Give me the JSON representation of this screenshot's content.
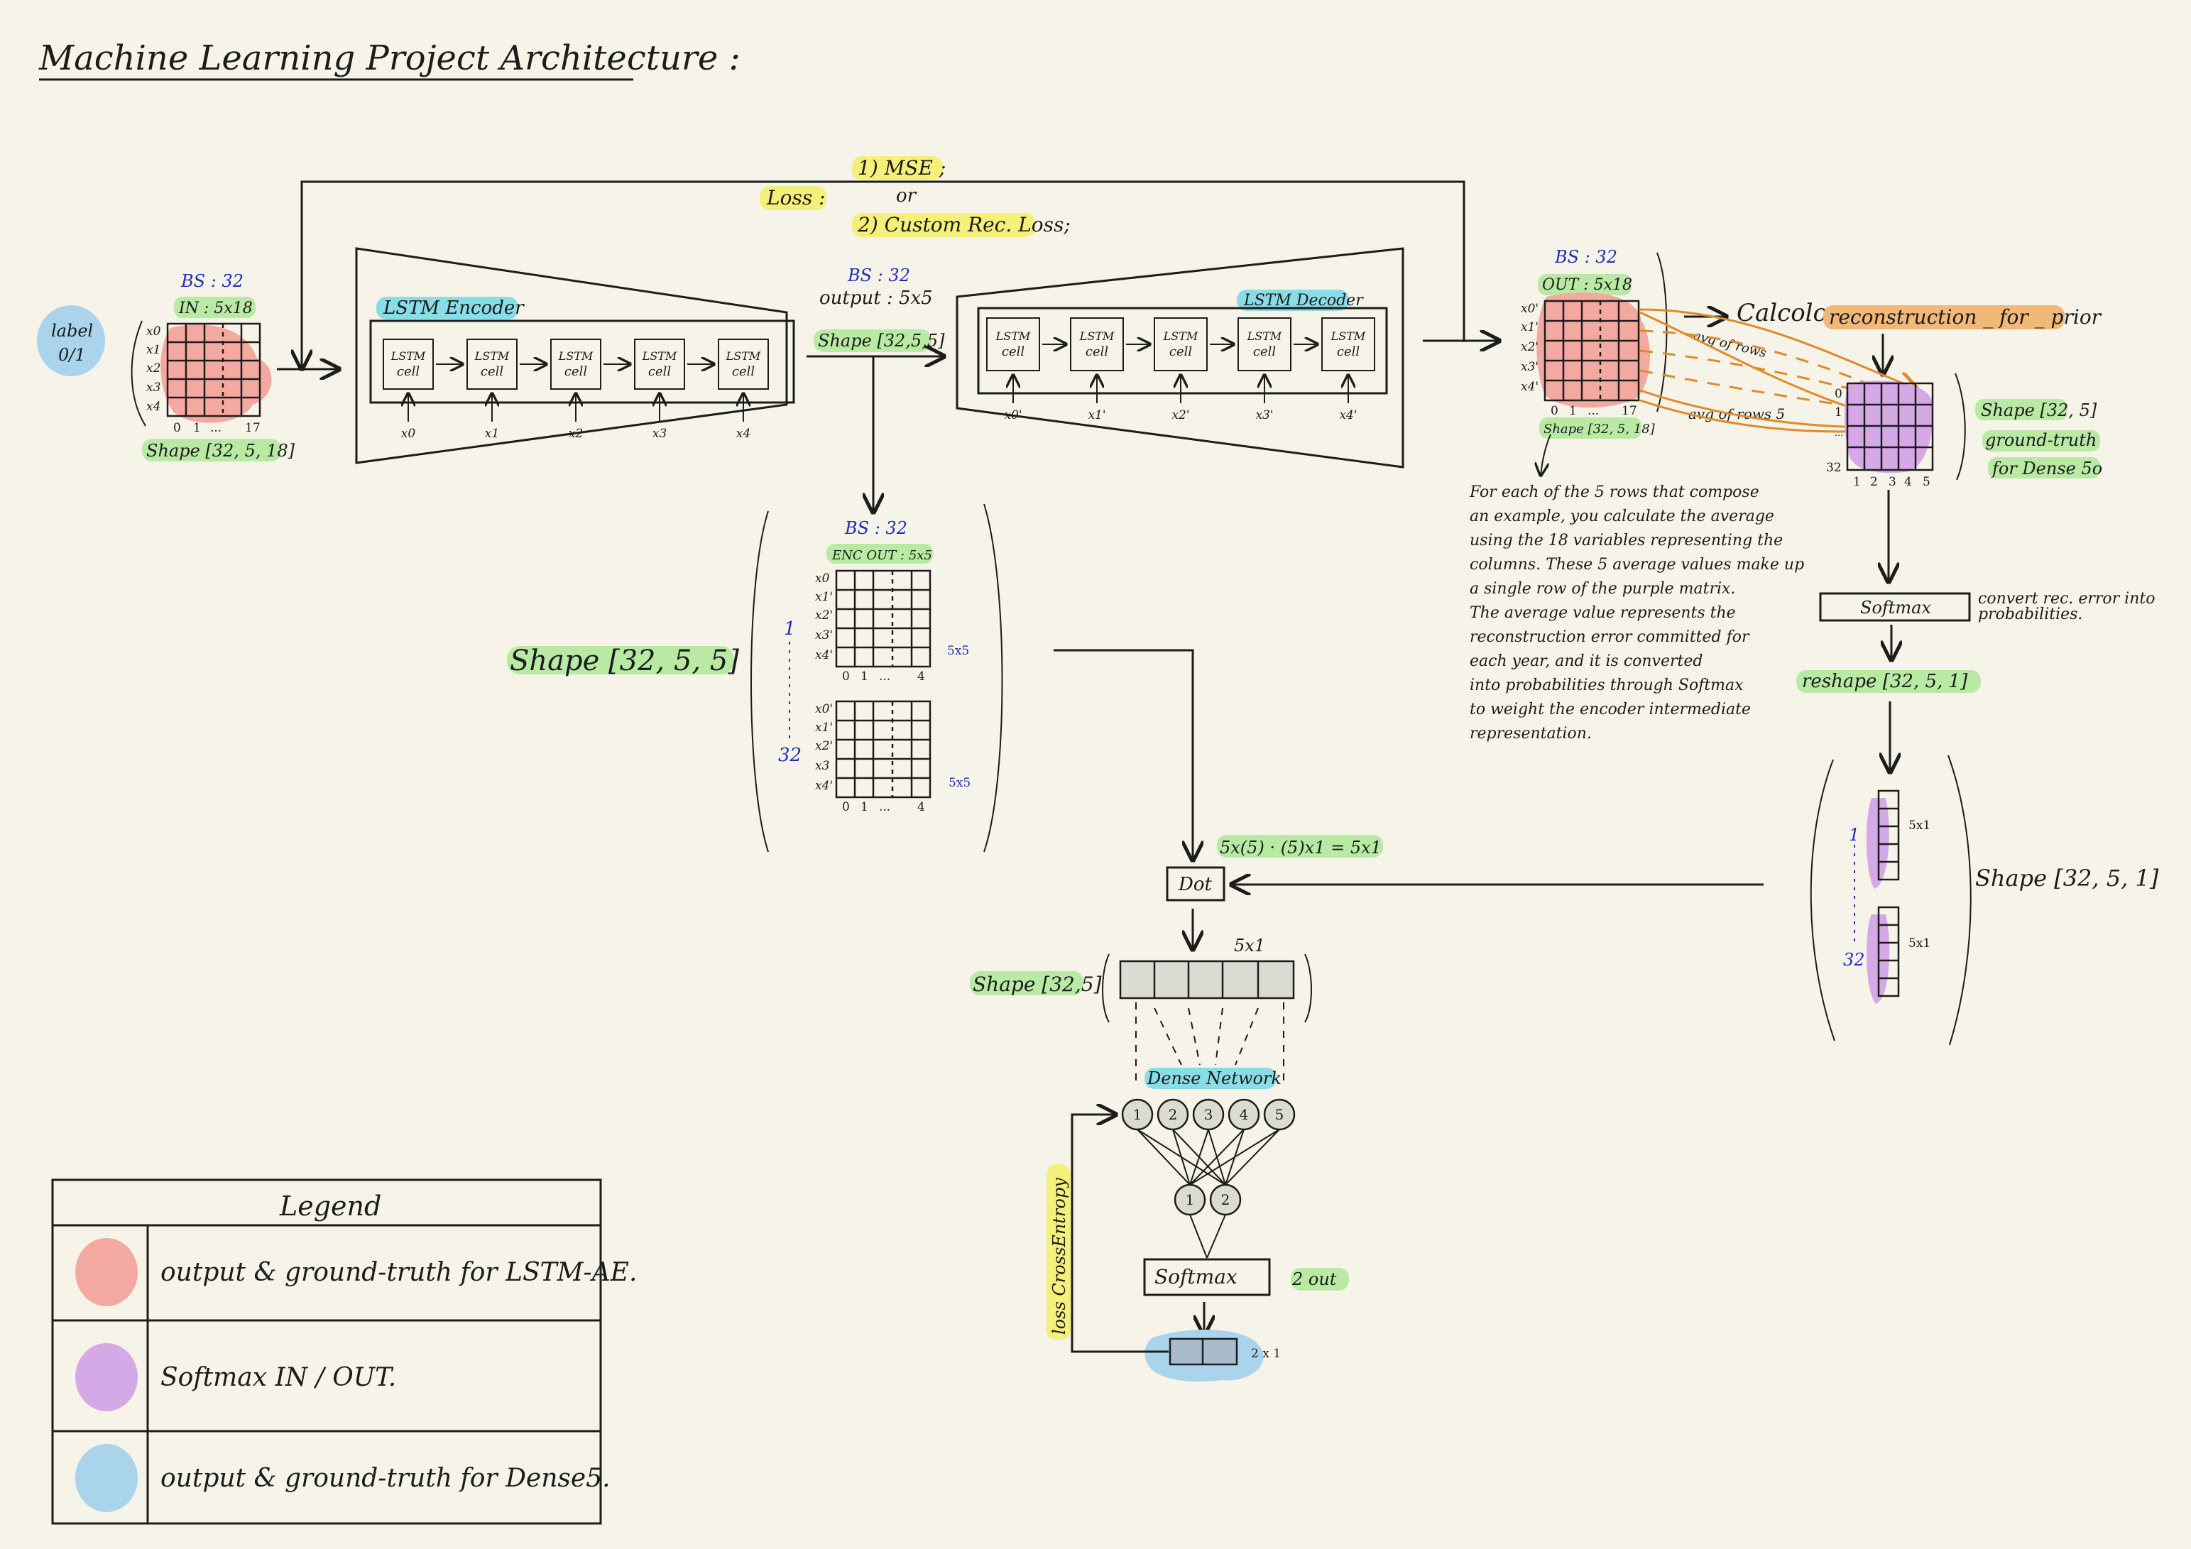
{
  "title": "Machine Learning Project Architecture :",
  "loss": {
    "label": "Loss :",
    "option1": "1) MSE ;",
    "or": "or",
    "option2": "2) Custom Rec. Loss;"
  },
  "input": {
    "label_blob": [
      "label",
      "0/1"
    ],
    "bs": "BS : 32",
    "in": "IN : 5x18",
    "rows": [
      "x0",
      "x1",
      "x2",
      "x3",
      "x4"
    ],
    "cols": [
      "0",
      "1",
      "...",
      "17"
    ],
    "shape": "Shape [32, 5, 18]"
  },
  "encoder": {
    "title": "LSTM Encoder",
    "cells": [
      "LSTM cell",
      "LSTM cell",
      "LSTM cell",
      "LSTM cell",
      "LSTM cell"
    ],
    "inputs": [
      "x0",
      "x1",
      "x2",
      "x3",
      "x4"
    ]
  },
  "encoder_output": {
    "bs": "BS : 32",
    "output": "output : 5x5",
    "shape": "Shape [32,5,5]"
  },
  "decoder": {
    "title": "LSTM Decoder",
    "cells": [
      "LSTM cell",
      "LSTM cell",
      "LSTM cell",
      "LSTM cell",
      "LSTM cell"
    ],
    "inputs": [
      "x0'",
      "x1'",
      "x2'",
      "x3'",
      "x4'"
    ]
  },
  "reconstruction": {
    "bs": "BS : 32",
    "out": "OUT : 5x18",
    "rows": [
      "x0'",
      "x1'",
      "x2'",
      "x3'",
      "x4'"
    ],
    "cols": [
      "0",
      "1",
      "...",
      "17"
    ],
    "shape": "Shape [32, 5, 18]",
    "calcolo": "Calcolo",
    "avg_rows": "avg of rows",
    "avg_rows_5": "avg of rows 5",
    "label": "reconstruction _ for _ prior"
  },
  "prior_matrix": {
    "rows": [
      "0",
      "1",
      "...",
      "32"
    ],
    "cols": [
      "1",
      "2",
      "3",
      "4",
      "5"
    ],
    "shape": "Shape [32, 5]",
    "gt1": "ground-truth",
    "gt2": "for Dense 5o"
  },
  "explanation": [
    "For each of the 5 rows that compose",
    "an example, you calculate the average",
    "using the 18 variables representing the",
    "columns. These 5 average values make up",
    "a single row of the purple matrix.",
    "The average value represents the",
    "reconstruction error committed for",
    "each year, and it is converted",
    "into probabilities through Softmax",
    "to weight the encoder intermediate",
    "representation."
  ],
  "softmax_right": {
    "label": "Softmax",
    "note": [
      "convert rec. error into",
      "probabilities."
    ],
    "reshape": "reshape [32, 5, 1]"
  },
  "weights_column": {
    "count_top": "1",
    "count_bottom": "32",
    "size_top": "5x1",
    "size_bottom": "5x1",
    "shape": "Shape [32, 5, 1]"
  },
  "enc_out_block": {
    "bs": "BS : 32",
    "enc_out": "ENC OUT : 5x5",
    "rows_top": [
      "x0",
      "x1'",
      "x2'",
      "x3'",
      "x4'"
    ],
    "rows_bottom": [
      "x0'",
      "x1'",
      "x2'",
      "x3",
      "x4'"
    ],
    "cols": [
      "0",
      "1",
      "...",
      "4"
    ],
    "size": "5x5",
    "count_top": "1",
    "count_bottom": "32",
    "shape": "Shape [32, 5, 5]"
  },
  "dot": {
    "label": "Dot",
    "formula": "5x(5) · (5)x1 = 5x1"
  },
  "dot_output": {
    "size": "5x1",
    "shape": "Shape [32,5]"
  },
  "dense": {
    "title": "Dense Network",
    "layer1": [
      "1",
      "2",
      "3",
      "4",
      "5"
    ],
    "layer2": [
      "1",
      "2"
    ],
    "loss": "loss CrossEntropy",
    "softmax": "Softmax",
    "out_note": "2 out",
    "final_size": "2 x 1"
  },
  "legend": {
    "title": "Legend",
    "items": [
      {
        "text": "output & ground-truth for LSTM-AE.",
        "color": "#f4a9a0"
      },
      {
        "text": "Softmax   IN / OUT.",
        "color": "#d5a9e6"
      },
      {
        "text": "output & ground-truth for Dense5.",
        "color": "#a9d4ec"
      }
    ]
  },
  "colors": {
    "background": "#f6f3e8",
    "salmon": "#f4a9a0",
    "purple": "#d5a9e6",
    "blue_blob": "#a9d4ec",
    "orange_line": "#e08a2a",
    "green_highlight": "#b9eaa4",
    "cyan_highlight": "#89dde6",
    "yellow_highlight": "#f5f07a"
  }
}
